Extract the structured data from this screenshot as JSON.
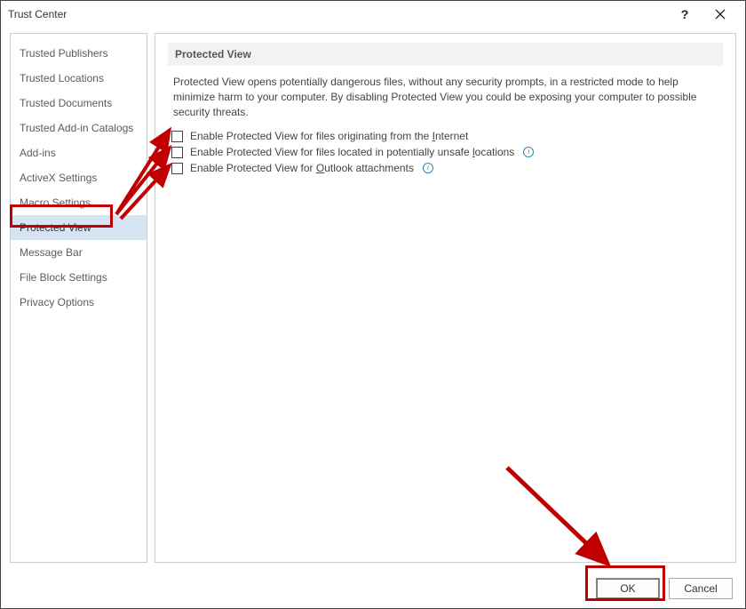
{
  "window": {
    "title": "Trust Center",
    "help_label": "?",
    "close_label": "Close"
  },
  "sidebar": {
    "items": [
      {
        "label": "Trusted Publishers"
      },
      {
        "label": "Trusted Locations"
      },
      {
        "label": "Trusted Documents"
      },
      {
        "label": "Trusted Add-in Catalogs"
      },
      {
        "label": "Add-ins"
      },
      {
        "label": "ActiveX Settings"
      },
      {
        "label": "Macro Settings"
      },
      {
        "label": "Protected View",
        "selected": true
      },
      {
        "label": "Message Bar"
      },
      {
        "label": "File Block Settings"
      },
      {
        "label": "Privacy Options"
      }
    ]
  },
  "content": {
    "section_title": "Protected View",
    "description": "Protected View opens potentially dangerous files, without any security prompts, in a restricted mode to help minimize harm to your computer. By disabling Protected View you could be exposing your computer to possible security threats.",
    "options": [
      {
        "label_pre": "Enable Protected View for files originating from the ",
        "u": "I",
        "label_post": "nternet",
        "info": false
      },
      {
        "label_pre": "Enable Protected View for files located in potentially unsafe ",
        "u": "l",
        "label_post": "ocations",
        "info": true
      },
      {
        "label_pre": "Enable Protected View for ",
        "u": "O",
        "label_post": "utlook attachments",
        "info": true
      }
    ]
  },
  "footer": {
    "ok": "OK",
    "cancel": "Cancel"
  }
}
